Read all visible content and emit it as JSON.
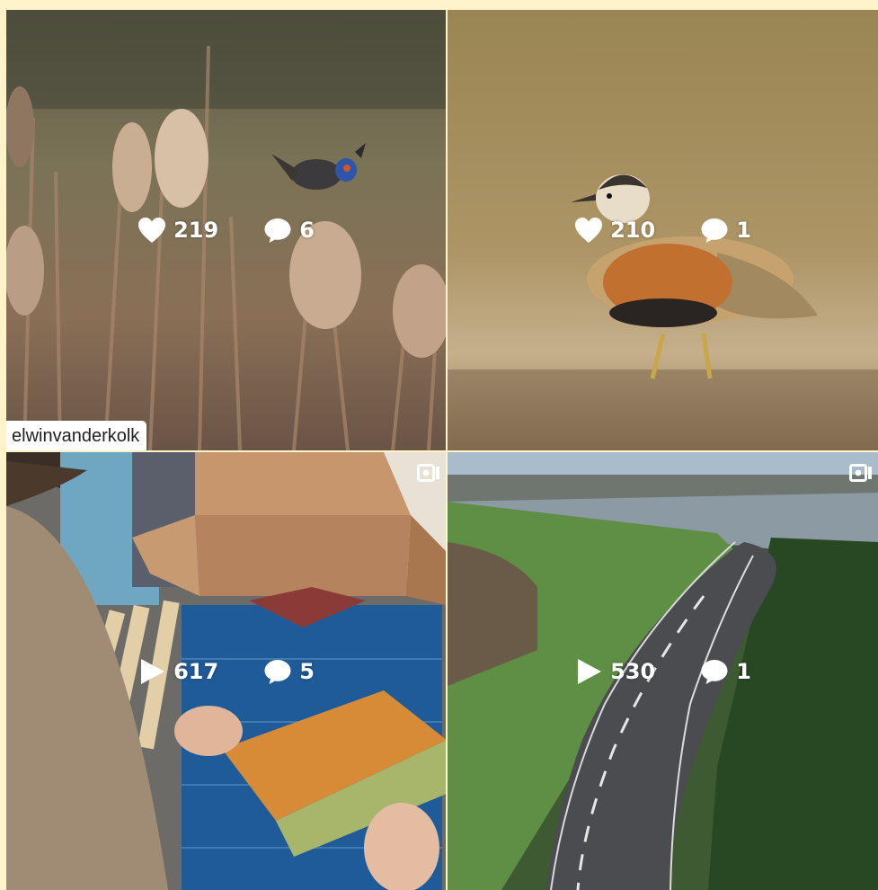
{
  "profile": {
    "username": "elwinvanderkolk"
  },
  "posts": [
    {
      "scene": "bluethroat-reeds",
      "type": "photo",
      "metric_icon": "heart-icon",
      "metric": "219",
      "comments": "6"
    },
    {
      "scene": "dotterel-field",
      "type": "photo",
      "metric_icon": "heart-icon",
      "metric": "210",
      "comments": "1"
    },
    {
      "scene": "parcel-unboxing",
      "type": "video",
      "metric_icon": "play-icon",
      "metric": "617",
      "comments": "5"
    },
    {
      "scene": "dike-road-aerial",
      "type": "video",
      "metric_icon": "play-icon",
      "metric": "530",
      "comments": "1"
    }
  ],
  "colors": {
    "page_background": "#fef3c9",
    "overlay_text": "#ffffff"
  }
}
